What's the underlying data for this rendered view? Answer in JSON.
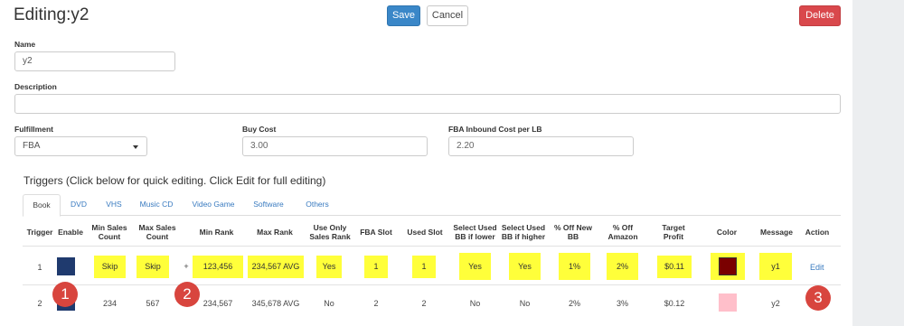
{
  "header": {
    "title": "Editing:y2",
    "save_label": "Save",
    "cancel_label": "Cancel",
    "delete_label": "Delete"
  },
  "form": {
    "name_label": "Name",
    "name_value": "y2",
    "description_label": "Description",
    "description_value": "",
    "fulfillment_label": "Fulfillment",
    "fulfillment_value": "FBA",
    "buy_cost_label": "Buy Cost",
    "buy_cost_value": "3.00",
    "fba_inbound_label": "FBA Inbound Cost per LB",
    "fba_inbound_value": "2.20"
  },
  "triggers": {
    "title": "Triggers (Click below for quick editing. Click Edit for full editing)",
    "tabs": [
      "Book",
      "DVD",
      "VHS",
      "Music CD",
      "Video Game",
      "Software",
      "Others"
    ],
    "active_tab": "Book",
    "columns": [
      [
        "Trigger",
        ""
      ],
      [
        "Enable",
        ""
      ],
      [
        "Min Sales",
        "Count"
      ],
      [
        "Max Sales",
        "Count"
      ],
      [
        "Min Rank",
        ""
      ],
      [
        "Max Rank",
        ""
      ],
      [
        "Use Only",
        "Sales Rank"
      ],
      [
        "FBA Slot",
        ""
      ],
      [
        "Used Slot",
        ""
      ],
      [
        "Select Used",
        "BB if lower"
      ],
      [
        "Select Used",
        "BB if higher"
      ],
      [
        "% Off New",
        "BB"
      ],
      [
        "% Off",
        "Amazon"
      ],
      [
        "Target",
        "Profit"
      ],
      [
        "Color",
        ""
      ],
      [
        "Message",
        ""
      ],
      [
        "Action",
        ""
      ]
    ],
    "rows": [
      {
        "trigger": "1",
        "min_sales": "Skip",
        "max_sales": "Skip",
        "plus": "+",
        "min_rank": "123,456",
        "max_rank": "234,567 AVG",
        "use_only": "Yes",
        "fba_slot": "1",
        "used_slot": "1",
        "bb_lower": "Yes",
        "bb_higher": "Yes",
        "off_new": "1%",
        "off_amazon": "2%",
        "target_profit": "$0.11",
        "color": "#7a0000",
        "message": "y1",
        "action": "Edit"
      },
      {
        "trigger": "2",
        "min_sales": "234",
        "max_sales": "567",
        "plus": "+",
        "min_rank": "234,567",
        "max_rank": "345,678 AVG",
        "use_only": "No",
        "fba_slot": "2",
        "used_slot": "2",
        "bb_lower": "No",
        "bb_higher": "No",
        "off_new": "2%",
        "off_amazon": "3%",
        "target_profit": "$0.12",
        "color": "#ffbfca",
        "message": "y2",
        "action": ""
      }
    ],
    "enable_color": "#1f3a6e",
    "highlight_color": "#ffff3a"
  },
  "annotations": [
    "1",
    "2",
    "3"
  ]
}
